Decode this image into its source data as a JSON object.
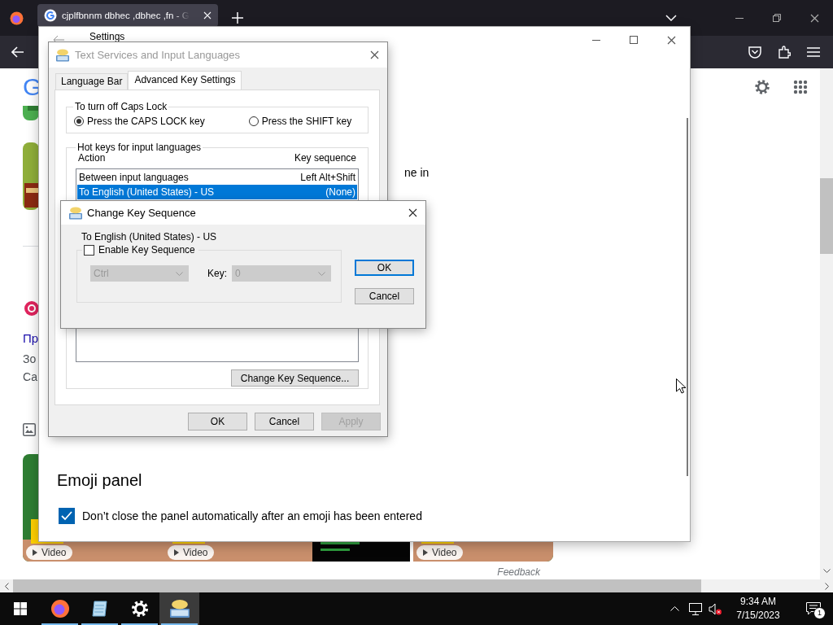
{
  "browser": {
    "tab": {
      "title": "cjplfbnnm dbhec ,dbhec ,fn - G"
    },
    "page": {
      "logo": "G",
      "snippets": [
        {
          "text": "Пр",
          "kind": "link"
        },
        {
          "text": "Зо",
          "kind": "text"
        },
        {
          "text": "Са",
          "kind": "text"
        }
      ],
      "tiles": [
        {
          "kind": "video",
          "badge": "Video"
        },
        {
          "kind": "video",
          "badge": "Video"
        },
        {
          "kind": "picture"
        },
        {
          "kind": "video",
          "badge": "Video"
        }
      ],
      "feedback": "Feedback"
    }
  },
  "settings": {
    "title": "Settings",
    "partial_text": "ne in",
    "section": "Emoji panel",
    "checkbox": {
      "label": "Don’t close the panel automatically after an emoji has been entered",
      "checked": true
    }
  },
  "text_services": {
    "title": "Text Services and Input Languages",
    "active": false,
    "tabs": [
      {
        "label": "Language Bar",
        "selected": false
      },
      {
        "label": "Advanced Key Settings",
        "selected": true
      }
    ],
    "caps_lock": {
      "title": "To turn off Caps Lock",
      "options": [
        {
          "label": "Press the CAPS LOCK key",
          "selected": true
        },
        {
          "label": "Press the SHIFT key",
          "selected": false
        }
      ]
    },
    "hot_keys": {
      "title": "Hot keys for input languages",
      "columns": [
        "Action",
        "Key sequence"
      ],
      "rows": [
        {
          "action": "Between input languages",
          "key": "Left Alt+Shift",
          "selected": false
        },
        {
          "action": "To English (United States) - US",
          "key": "(None)",
          "selected": true
        }
      ],
      "button": "Change Key Sequence..."
    },
    "buttons": [
      {
        "label": "OK",
        "disabled": false
      },
      {
        "label": "Cancel",
        "disabled": false
      },
      {
        "label": "Apply",
        "disabled": true
      }
    ]
  },
  "change_key": {
    "title": "Change Key Sequence",
    "active": true,
    "subject": "To English (United States) - US",
    "enable": {
      "label": "Enable Key Sequence",
      "checked": false
    },
    "modifier": {
      "value": "Ctrl",
      "disabled": true
    },
    "key_label": "Key:",
    "key": {
      "value": "0",
      "disabled": true
    },
    "buttons": [
      {
        "label": "OK",
        "default": true
      },
      {
        "label": "Cancel",
        "default": false
      }
    ]
  },
  "taskbar": {
    "apps": [
      {
        "kind": "start",
        "running": false,
        "active": false
      },
      {
        "kind": "firefox",
        "running": true,
        "active": false
      },
      {
        "kind": "notepad",
        "running": true,
        "active": false
      },
      {
        "kind": "settings",
        "running": true,
        "active": false
      },
      {
        "kind": "keyboard",
        "running": true,
        "active": true
      }
    ],
    "clock": {
      "time": "9:34 AM",
      "date": "7/15/2023"
    },
    "notifications": "1"
  }
}
